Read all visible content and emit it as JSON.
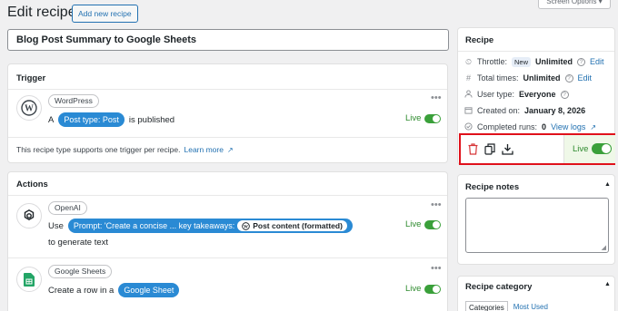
{
  "header": {
    "title": "Edit recipe",
    "add_new_label": "Add new recipe",
    "screen_options_label": "Screen Options ▾"
  },
  "recipe_name": "Blog Post Summary to Google Sheets",
  "trigger": {
    "section_title": "Trigger",
    "integration": "WordPress",
    "prefix": "A",
    "token": "Post type: Post",
    "suffix": "is published",
    "status": "Live",
    "note": "This recipe type supports one trigger per recipe.",
    "learn_more": "Learn more"
  },
  "actions": {
    "section_title": "Actions",
    "items": [
      {
        "integration": "OpenAI",
        "prefix": "Use",
        "token_text": "Prompt: 'Create a concise ... key takeaways:",
        "inner_token": "Post content (formatted)",
        "line2": "to generate text",
        "status": "Live"
      },
      {
        "integration": "Google Sheets",
        "prefix": "Create a row in a",
        "token_text": "Google Sheet",
        "status": "Live"
      }
    ]
  },
  "recipe_panel": {
    "title": "Recipe",
    "throttle_label": "Throttle:",
    "throttle_badge": "New",
    "throttle_value": "Unlimited",
    "throttle_edit": "Edit",
    "total_label": "Total times:",
    "total_value": "Unlimited",
    "total_edit": "Edit",
    "user_type_label": "User type:",
    "user_type_value": "Everyone",
    "created_label": "Created on:",
    "created_value": "January 8, 2026",
    "completed_label": "Completed runs:",
    "completed_value": "0",
    "view_logs": "View logs",
    "status": "Live"
  },
  "notes_panel": {
    "title": "Recipe notes"
  },
  "category_panel": {
    "title": "Recipe category",
    "tabs": [
      "Categories",
      "Most Used"
    ]
  },
  "colors": {
    "accent": "#2271b1",
    "live_green": "#3aa03a",
    "highlight_red": "#e0111b",
    "token_blue": "#2a8ad4"
  }
}
